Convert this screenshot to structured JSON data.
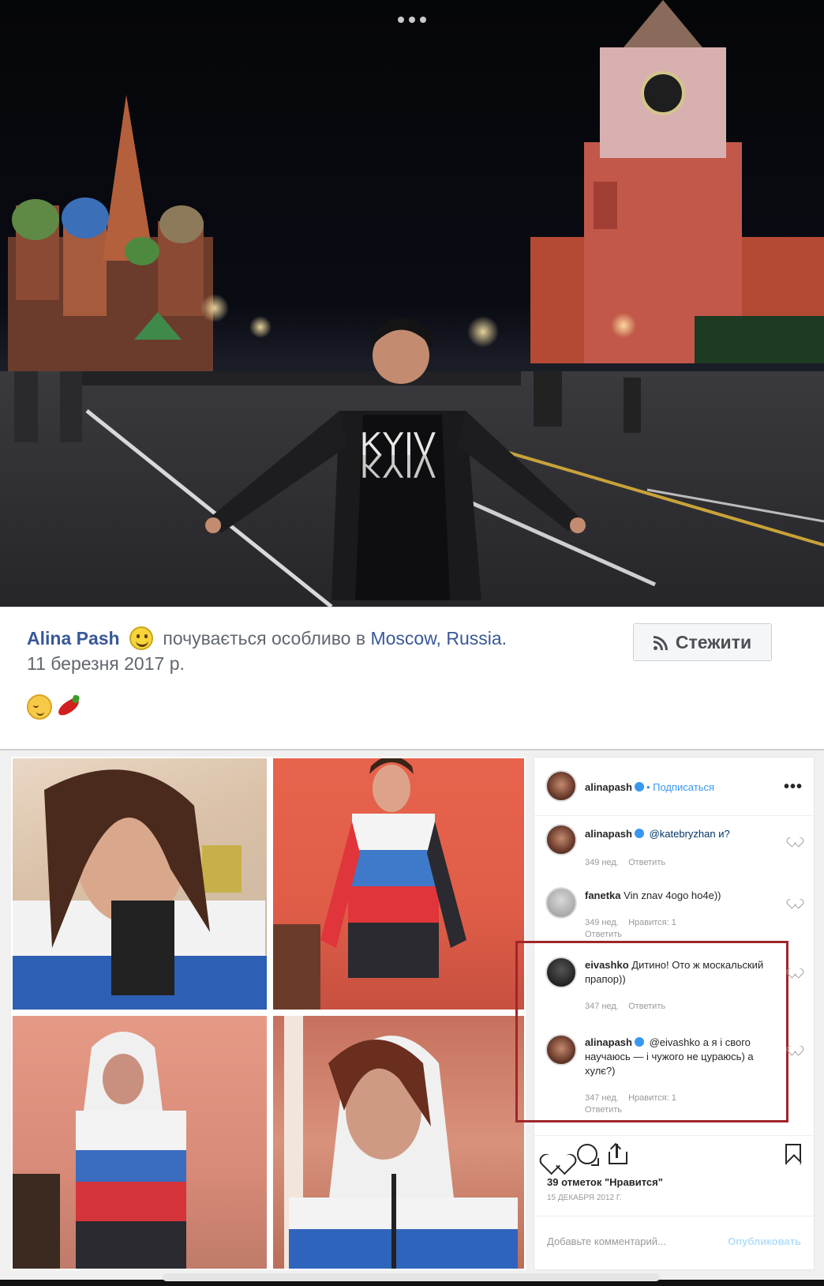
{
  "facebook_post": {
    "author": "Alina Pash",
    "feeling": "почувається особливо в",
    "location": "Moscow, Russia.",
    "date": "11 березня 2017 р.",
    "follow_label": "Стежити"
  },
  "photo_shirt_text": "KYIV",
  "instagram": {
    "header_user": "alinapash",
    "subscribe_label": "• Подписаться",
    "comments": [
      {
        "user": "alinapash",
        "text": "@katebryzhan и?",
        "time": "349 нед.",
        "reply": "Ответить",
        "likes": ""
      },
      {
        "user": "fanetka",
        "text": "Vin znav 4ogo ho4e))",
        "time": "349 нед.",
        "reply": "Ответить",
        "likes": "Нравится: 1"
      },
      {
        "user": "eivashko",
        "text": "Дитино! Ото ж москальский прапор))",
        "time": "347 нед.",
        "reply": "Ответить",
        "likes": ""
      },
      {
        "user": "alinapash",
        "text": "@eivashko а я і свого научаюсь — і чужого не цураюсь) а хулє?)",
        "time": "347 нед.",
        "reply": "Ответить",
        "likes": "Нравится: 1"
      }
    ],
    "likes_count": "39 отметок \"Нравится\"",
    "post_date": "15 декабря 2012 г.",
    "add_comment_placeholder": "Добавьте комментарий...",
    "publish_label": "Опубликовать"
  },
  "colors": {
    "fb_link": "#385898",
    "ig_blue": "#3897f0",
    "highlight": "#a0262a"
  }
}
